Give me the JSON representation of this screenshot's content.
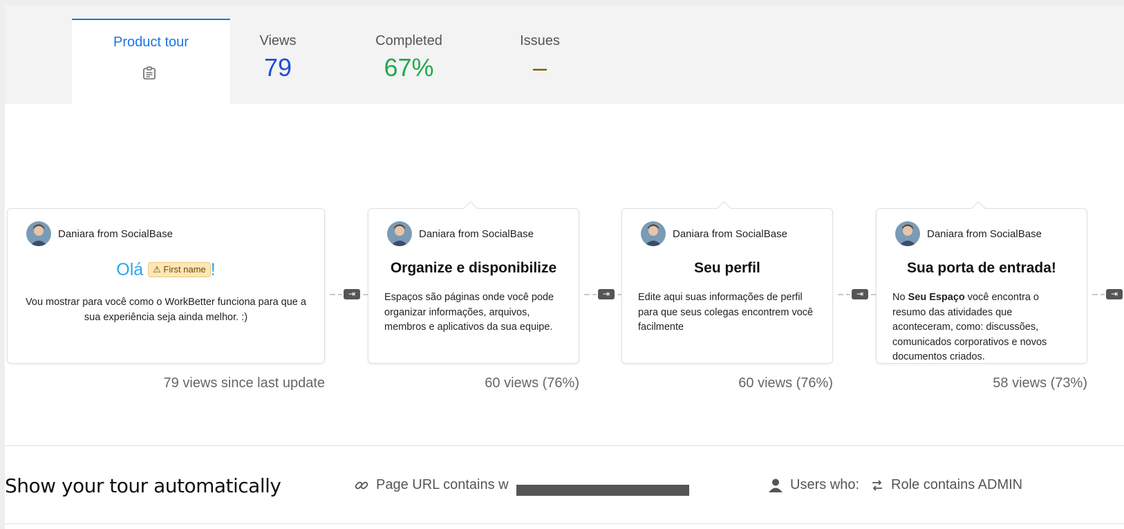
{
  "stats": {
    "tab_label": "Product tour",
    "tab_icon": "clipboard-icon",
    "views_label": "Views",
    "views_value": "79",
    "completed_label": "Completed",
    "completed_value": "67%",
    "issues_label": "Issues",
    "issues_value": "–",
    "colors": {
      "accent": "#1a73e8",
      "views": "#1d4ed8",
      "completed": "#22a94e",
      "issues": "#7a5a00"
    }
  },
  "steps": [
    {
      "sender": "Daniara from SocialBase",
      "greeting": "Olá",
      "token": "First name",
      "greeting_end": "!",
      "body": "Vou mostrar para você como o WorkBetter funciona para que a sua experiência seja ainda melhor. :)",
      "views": "79 views since last update"
    },
    {
      "sender": "Daniara from SocialBase",
      "title": "Organize e disponibilize",
      "body": "Espaços são páginas onde você pode organizar informações, arquivos, membros e aplicativos da sua equipe.",
      "views": "60 views (76%)"
    },
    {
      "sender": "Daniara from SocialBase",
      "title": "Seu perfil",
      "body": "Edite aqui suas informações de perfil para que seus colegas encontrem você facilmente",
      "views": "60 views (76%)"
    },
    {
      "sender": "Daniara from SocialBase",
      "title": "Sua porta de entrada!",
      "body_pre": "No ",
      "body_bold": "Seu Espaço",
      "body_post": " você encontra o resumo das atividades que aconteceram, como: discussões, comunicados corporativos e novos documentos criados.",
      "views": "58 views (73%)"
    }
  ],
  "auto": {
    "title": "Show your tour automatically",
    "url_rule": "Page URL contains w",
    "users_label": "Users who:",
    "role_rule": "Role contains ADMIN"
  }
}
